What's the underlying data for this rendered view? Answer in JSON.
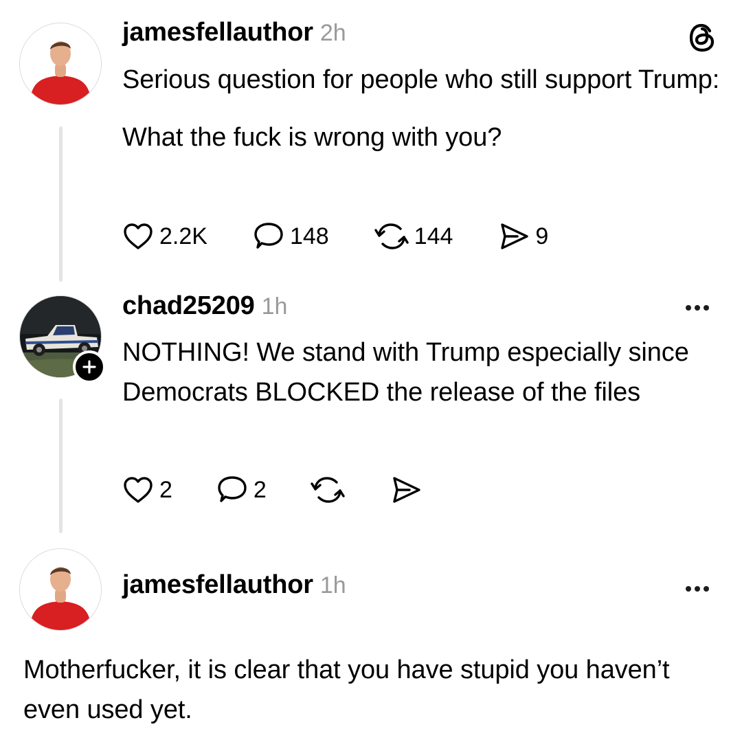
{
  "posts": [
    {
      "username": "jamesfellauthor",
      "time": "2h",
      "paragraphs": [
        "Serious question for people who still support Trump:",
        "What the fuck is wrong with you?"
      ],
      "likes": "2.2K",
      "replies": "148",
      "reposts": "144",
      "shares": "9",
      "avatar_icon": "person-red-shirt"
    },
    {
      "username": "chad25209",
      "time": "1h",
      "paragraphs": [
        "NOTHING! We stand with Trump especially since Democrats BLOCKED the release of the files"
      ],
      "likes": "2",
      "replies": "2",
      "avatar_icon": "pickup-truck"
    },
    {
      "username": "jamesfellauthor",
      "time": "1h",
      "paragraphs": [
        "Motherfucker, it is clear that you have stupid you haven’t even used yet."
      ],
      "avatar_icon": "person-red-shirt"
    }
  ],
  "icons": {
    "app_logo": "threads-logo",
    "more": "more-icon",
    "like": "heart-icon",
    "reply": "comment-icon",
    "repost": "repost-icon",
    "share": "send-icon",
    "follow": "plus-icon"
  },
  "colors": {
    "text": "#000000",
    "timestamp": "#999999",
    "thread_line": "#e3e3e3"
  }
}
